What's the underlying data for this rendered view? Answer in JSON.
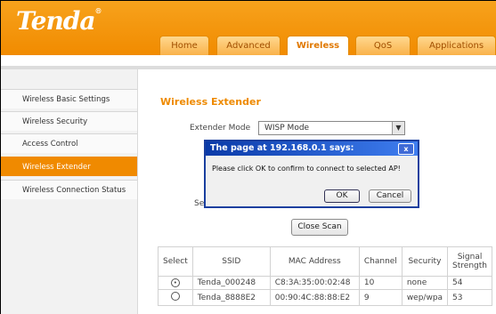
{
  "brand": {
    "logo": "Tenda",
    "reg_mark": "®"
  },
  "tabs": [
    {
      "label": "Home"
    },
    {
      "label": "Advanced"
    },
    {
      "label": "Wireless"
    },
    {
      "label": "QoS"
    },
    {
      "label": "Applications"
    }
  ],
  "sidebar": {
    "items": [
      {
        "label": "Wireless Basic Settings"
      },
      {
        "label": "Wireless Security"
      },
      {
        "label": "Access Control"
      },
      {
        "label": "Wireless Extender"
      },
      {
        "label": "Wireless Connection Status"
      }
    ]
  },
  "main": {
    "title": "Wireless Extender",
    "mode_label": "Extender Mode",
    "mode_value": "WISP Mode",
    "partial_label": "Se",
    "close_scan": "Close Scan"
  },
  "table": {
    "headers": [
      "Select",
      "SSID",
      "MAC Address",
      "Channel",
      "Security",
      "Signal Strength"
    ],
    "rows": [
      {
        "selected": "•",
        "ssid": "Tenda_000248",
        "mac": "C8:3A:35:00:02:48",
        "channel": "10",
        "security": "none",
        "signal": "54"
      },
      {
        "selected": "",
        "ssid": "Tenda_8888E2",
        "mac": "00:90:4C:88:88:E2",
        "channel": "9",
        "security": "wep/wpa",
        "signal": "53"
      }
    ]
  },
  "dialog": {
    "title": "The page at 192.168.0.1 says:",
    "close": "x",
    "message": "Please click OK to confirm to connect to selected AP!",
    "ok": "OK",
    "cancel": "Cancel"
  }
}
